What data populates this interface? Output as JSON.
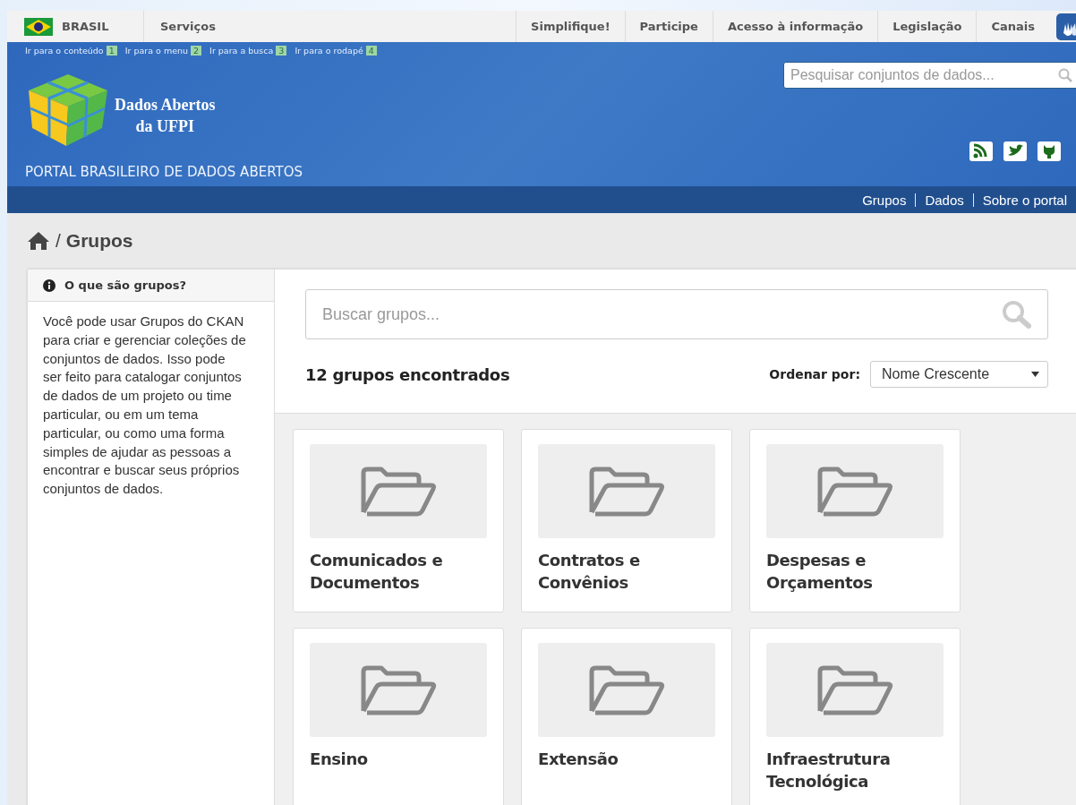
{
  "gov_bar": {
    "country": "BRASIL",
    "services": "Serviços",
    "links": [
      "Simplifique!",
      "Participe",
      "Acesso à informação",
      "Legislação",
      "Canais"
    ]
  },
  "skip_links": [
    {
      "label": "Ir para o conteúdo",
      "key": "1"
    },
    {
      "label": "Ir para o menu",
      "key": "2"
    },
    {
      "label": "Ir para a busca",
      "key": "3"
    },
    {
      "label": "Ir para o rodapé",
      "key": "4"
    }
  ],
  "header": {
    "logo_line1": "Dados Abertos",
    "logo_line2": "da UFPI",
    "portal": "PORTAL BRASILEIRO DE DADOS ABERTOS",
    "search_placeholder": "Pesquisar conjuntos de dados..."
  },
  "nav": [
    "Grupos",
    "Dados",
    "Sobre o portal"
  ],
  "breadcrumb": {
    "separator": "/",
    "current": "Grupos"
  },
  "sidebar": {
    "title": "O que são grupos?",
    "text": "Você pode usar Grupos do CKAN para criar e gerenciar coleções de conjuntos de dados. Isso pode ser feito para catalogar conjuntos de dados de um projeto ou time particular, ou em um tema particular, ou como uma forma simples de ajudar as pessoas a encontrar e buscar seus próprios conjuntos de dados."
  },
  "search": {
    "placeholder": "Buscar grupos..."
  },
  "result_count": "12 grupos encontrados",
  "sort": {
    "label": "Ordenar por:",
    "value": "Nome Crescente"
  },
  "groups": [
    {
      "name": "Comunicados e Documentos"
    },
    {
      "name": "Contratos e Convênios"
    },
    {
      "name": "Despesas e Orçamentos"
    },
    {
      "name": "Ensino"
    },
    {
      "name": "Extensão"
    },
    {
      "name": "Infraestrutura Tecnológica"
    }
  ]
}
